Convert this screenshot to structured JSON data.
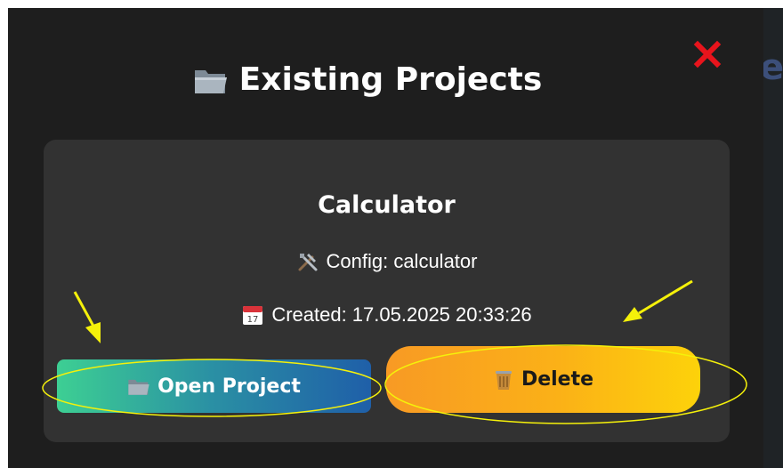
{
  "modal": {
    "title": "Existing Projects",
    "close_symbol": "✕"
  },
  "project": {
    "name": "Calculator",
    "config_label": "Config: calculator",
    "created_label": "Created: 17.05.2025 20:33:26"
  },
  "actions": {
    "open_label": "Open Project",
    "delete_label": "Delete"
  },
  "background": {
    "peek_letter": "e"
  },
  "colors": {
    "modal_bg": "#1e1e1e",
    "card_bg": "#323232",
    "close_red": "#e8141c",
    "annotation_yellow": "#f5f10a"
  },
  "icons": {
    "title": "folder-icon",
    "config": "tools-icon",
    "created": "calendar-icon",
    "open": "folder-icon",
    "delete": "wastebasket-icon"
  }
}
